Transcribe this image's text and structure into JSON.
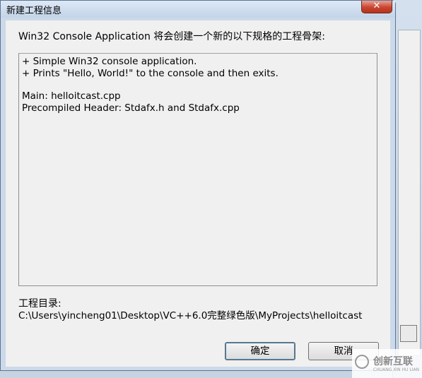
{
  "window": {
    "title": "新建工程信息",
    "close_glyph": "✕"
  },
  "heading": "Win32 Console Application 将会创建一个新的以下规格的工程骨架:",
  "info_lines": [
    "+ Simple Win32 console application.",
    "+ Prints \"Hello, World!\" to the console and then exits.",
    "Main: helloitcast.cpp",
    "Precompiled Header: Stdafx.h and Stdafx.cpp"
  ],
  "project_dir": {
    "label": "工程目录:",
    "path": "C:\\Users\\yincheng01\\Desktop\\VC++6.0完整绿色版\\MyProjects\\helloitcast"
  },
  "buttons": {
    "ok": "确定",
    "cancel": "取消"
  },
  "watermark": {
    "text": "创新互联",
    "sub": "CHUANG XIN HU LIAN"
  },
  "colors": {
    "dialog_frame": "#cbd9e9",
    "client_bg": "#f0f0f0",
    "close_button": "#c9452f"
  }
}
